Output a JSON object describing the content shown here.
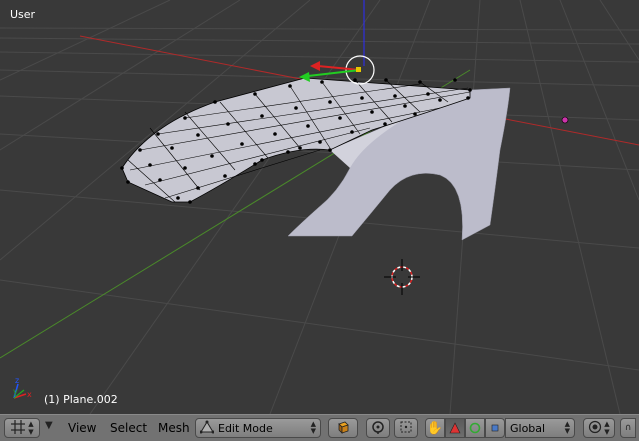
{
  "viewport": {
    "view_label": "User",
    "object_label": "(1) Plane.002"
  },
  "header": {
    "editor_type_icon": "3d-view-grid-icon",
    "menus": [
      "View",
      "Select",
      "Mesh"
    ],
    "mode_select": "Edit Mode",
    "mode_icon": "edit-mode-triangle-icon",
    "shading_icon": "solid-cube-icon",
    "pivot_icon": "pivot-point-icon",
    "transform_icons": [
      "hand-manipulator-icon",
      "translate-arrow-icon",
      "rotate-ring-icon",
      "scale-box-icon"
    ],
    "orientation_select": "Global",
    "snap_icon": "proportional-edit-icon"
  },
  "colors": {
    "background": "#393939",
    "grid": "#4a4a4a",
    "x_axis": "#b02a2a",
    "y_axis": "#4a8a2a",
    "z_axis": "#2a2aff",
    "vertex": "#000000",
    "mesh_face": "#c8c8d2",
    "header": "#727272"
  }
}
